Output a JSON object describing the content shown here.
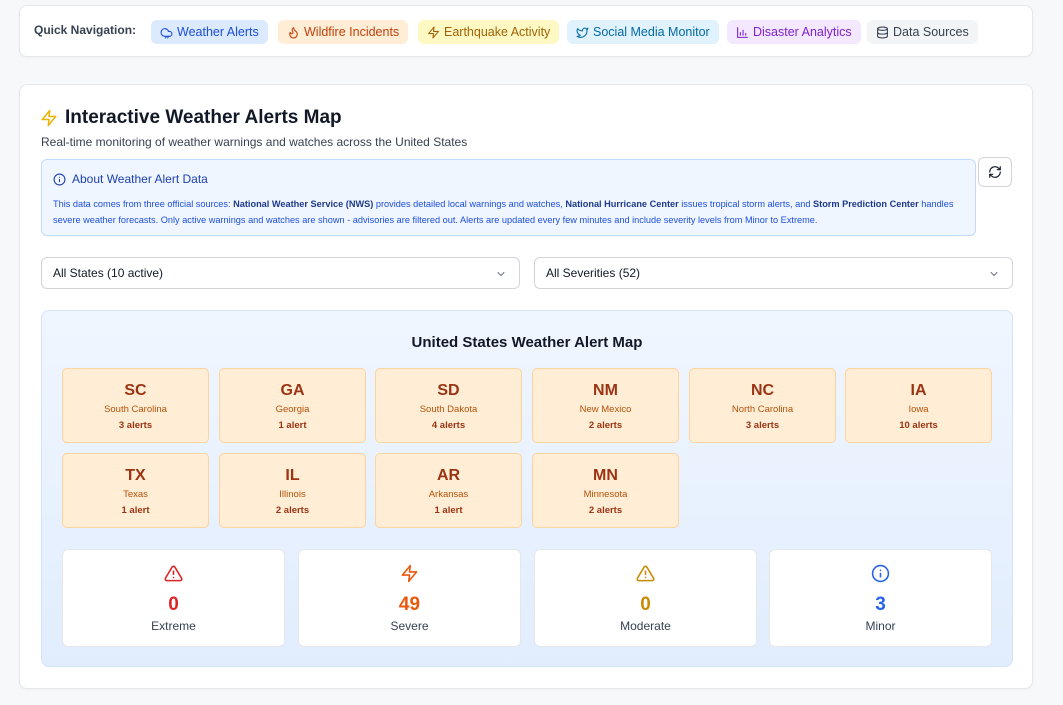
{
  "nav": {
    "label": "Quick Navigation:",
    "items": [
      {
        "label": "Weather Alerts",
        "icon": "cloud-icon",
        "bg": "#dbeafe",
        "fg": "#1d4ed8"
      },
      {
        "label": "Wildfire Incidents",
        "icon": "flame-icon",
        "bg": "#ffedd5",
        "fg": "#c2410c"
      },
      {
        "label": "Earthquake Activity",
        "icon": "zap-icon",
        "bg": "#fef9c3",
        "fg": "#a16207"
      },
      {
        "label": "Social Media Monitor",
        "icon": "twitter-icon",
        "bg": "#e0f2fe",
        "fg": "#0369a1"
      },
      {
        "label": "Disaster Analytics",
        "icon": "bar-chart-icon",
        "bg": "#f3e8ff",
        "fg": "#7e22ce"
      },
      {
        "label": "Data Sources",
        "icon": "database-icon",
        "bg": "#f3f4f6",
        "fg": "#374151"
      }
    ]
  },
  "header": {
    "title": "Interactive Weather Alerts Map",
    "subtitle": "Real-time monitoring of weather warnings and watches across the United States"
  },
  "info": {
    "title": "About Weather Alert Data",
    "t1": "This data comes from three official sources: ",
    "b1": "National Weather Service (NWS)",
    "t2": " provides detailed local warnings and watches, ",
    "b2": "National Hurricane Center",
    "t3": " issues tropical storm alerts, and ",
    "b3": "Storm Prediction Center",
    "t4": " handles severe weather forecasts. Only active warnings and watches are shown - advisories are filtered out. Alerts are updated every few minutes and include severity levels from Minor to Extreme."
  },
  "filters": {
    "state": "All States (10 active)",
    "severity": "All Severities (52)"
  },
  "map": {
    "title": "United States Weather Alert Map",
    "states": [
      {
        "code": "SC",
        "name": "South Carolina",
        "count": "3 alerts"
      },
      {
        "code": "GA",
        "name": "Georgia",
        "count": "1 alert"
      },
      {
        "code": "SD",
        "name": "South Dakota",
        "count": "4 alerts"
      },
      {
        "code": "NM",
        "name": "New Mexico",
        "count": "2 alerts"
      },
      {
        "code": "NC",
        "name": "North Carolina",
        "count": "3 alerts"
      },
      {
        "code": "IA",
        "name": "Iowa",
        "count": "10 alerts"
      },
      {
        "code": "TX",
        "name": "Texas",
        "count": "1 alert"
      },
      {
        "code": "IL",
        "name": "Illinois",
        "count": "2 alerts"
      },
      {
        "code": "AR",
        "name": "Arkansas",
        "count": "1 alert"
      },
      {
        "code": "MN",
        "name": "Minnesota",
        "count": "2 alerts"
      }
    ]
  },
  "severity": [
    {
      "value": "0",
      "label": "Extreme",
      "icon": "alert-triangle-icon",
      "color": "#dc2626"
    },
    {
      "value": "49",
      "label": "Severe",
      "icon": "zap-icon",
      "color": "#ea580c"
    },
    {
      "value": "0",
      "label": "Moderate",
      "icon": "alert-triangle-icon",
      "color": "#ca8a04"
    },
    {
      "value": "3",
      "label": "Minor",
      "icon": "info-icon",
      "color": "#2563eb"
    }
  ]
}
